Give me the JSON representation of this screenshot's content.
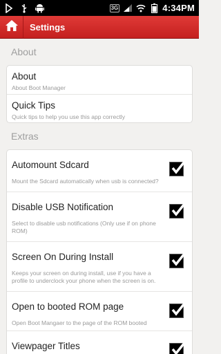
{
  "statusbar": {
    "time": "4:34PM",
    "network_badge": "3G",
    "left_icons": [
      "usb-debug-icon",
      "usb-icon",
      "android-icon"
    ],
    "right_icons": [
      "wifi-icon",
      "signal-icon",
      "battery-icon",
      "alarm-icon"
    ]
  },
  "actionbar": {
    "title": "Settings",
    "home_icon": "home-icon",
    "accent": "#d32f2f"
  },
  "sections": [
    {
      "header": "About",
      "items": [
        {
          "title": "About",
          "summary": "About Boot Manager"
        },
        {
          "title": "Quick Tips",
          "summary": "Quick tips to help you use this app correctly"
        }
      ]
    },
    {
      "header": "Extras",
      "items": [
        {
          "title": "Automount Sdcard",
          "summary": "Mount the Sdcard automatically when usb is connected?",
          "checked": true
        },
        {
          "title": "Disable USB Notification",
          "summary": "Select to disable usb notifications (Only use if on phone ROM)",
          "checked": true
        },
        {
          "title": "Screen On During Install",
          "summary": "Keeps your screen on during install, use if you have a profile to underclock your phone when the screen is on.",
          "checked": true
        },
        {
          "title": "Open to booted ROM page",
          "summary": "Open Boot Mangaer to the page of the ROM booted",
          "checked": true
        },
        {
          "title": "Viewpager Titles",
          "summary": "",
          "checked": true
        }
      ]
    }
  ]
}
